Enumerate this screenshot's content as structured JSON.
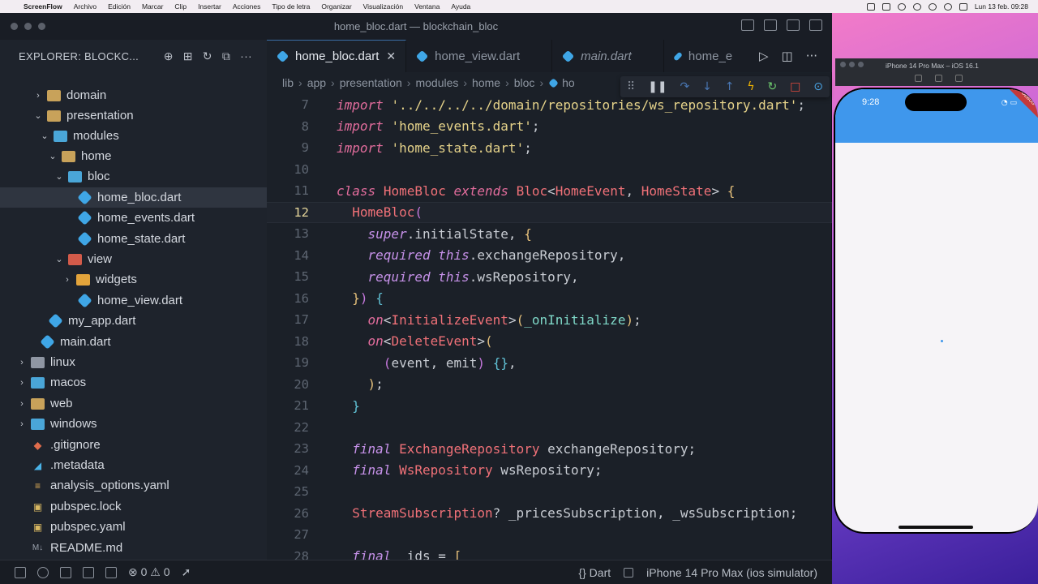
{
  "menubar": {
    "app": "ScreenFlow",
    "items": [
      "Archivo",
      "Edición",
      "Marcar",
      "Clip",
      "Insertar",
      "Acciones",
      "Tipo de letra",
      "Organizar",
      "Visualización",
      "Ventana",
      "Ayuda"
    ],
    "clock": "Lun 13 feb.  09:28"
  },
  "window": {
    "title": "home_bloc.dart — blockchain_bloc"
  },
  "explorer": {
    "header": "EXPLORER: BLOCKC...",
    "items": [
      {
        "label": "domain",
        "icon": "folder-icon"
      },
      {
        "label": "presentation",
        "icon": "folder-icon"
      },
      {
        "label": "modules",
        "icon": "modules-folder-icon"
      },
      {
        "label": "home",
        "icon": "folder-icon"
      },
      {
        "label": "bloc",
        "icon": "bloc-folder-icon"
      },
      {
        "label": "home_bloc.dart",
        "icon": "dart-icon"
      },
      {
        "label": "home_events.dart",
        "icon": "dart-icon"
      },
      {
        "label": "home_state.dart",
        "icon": "dart-icon"
      },
      {
        "label": "view",
        "icon": "view-folder-icon"
      },
      {
        "label": "widgets",
        "icon": "widgets-folder-icon"
      },
      {
        "label": "home_view.dart",
        "icon": "dart-icon"
      },
      {
        "label": "my_app.dart",
        "icon": "dart-icon"
      },
      {
        "label": "main.dart",
        "icon": "dart-icon"
      },
      {
        "label": "linux",
        "icon": "folder-icon"
      },
      {
        "label": "macos",
        "icon": "folder-icon"
      },
      {
        "label": "web",
        "icon": "folder-icon"
      },
      {
        "label": "windows",
        "icon": "folder-icon"
      },
      {
        "label": ".gitignore",
        "icon": "git-icon"
      },
      {
        "label": ".metadata",
        "icon": "metadata-icon"
      },
      {
        "label": "analysis_options.yaml",
        "icon": "yaml-icon"
      },
      {
        "label": "pubspec.lock",
        "icon": "lock-icon"
      },
      {
        "label": "pubspec.yaml",
        "icon": "yaml-icon"
      },
      {
        "label": "README.md",
        "icon": "markdown-icon"
      }
    ]
  },
  "tabs": [
    {
      "label": "home_bloc.dart",
      "active": true
    },
    {
      "label": "home_view.dart"
    },
    {
      "label": "main.dart"
    },
    {
      "label": "home_e"
    }
  ],
  "breadcrumb": [
    "lib",
    "app",
    "presentation",
    "modules",
    "home",
    "bloc",
    "ho"
  ],
  "code": {
    "lines": [
      {
        "n": "7",
        "text": "import '../../../../domain/repositories/ws_repository.dart';"
      },
      {
        "n": "8",
        "text": "import 'home_events.dart';"
      },
      {
        "n": "9",
        "text": "import 'home_state.dart';"
      },
      {
        "n": "10",
        "text": ""
      },
      {
        "n": "11",
        "text": "class HomeBloc extends Bloc<HomeEvent, HomeState> {"
      },
      {
        "n": "12",
        "text": "  HomeBloc("
      },
      {
        "n": "13",
        "text": "    super.initialState, {"
      },
      {
        "n": "14",
        "text": "    required this.exchangeRepository,"
      },
      {
        "n": "15",
        "text": "    required this.wsRepository,"
      },
      {
        "n": "16",
        "text": "  }) {"
      },
      {
        "n": "17",
        "text": "    on<InitializeEvent>(_onInitialize);"
      },
      {
        "n": "18",
        "text": "    on<DeleteEvent>("
      },
      {
        "n": "19",
        "text": "      (event, emit) {},"
      },
      {
        "n": "20",
        "text": "    );"
      },
      {
        "n": "21",
        "text": "  }"
      },
      {
        "n": "22",
        "text": ""
      },
      {
        "n": "23",
        "text": "  final ExchangeRepository exchangeRepository;"
      },
      {
        "n": "24",
        "text": "  final WsRepository wsRepository;"
      },
      {
        "n": "25",
        "text": ""
      },
      {
        "n": "26",
        "text": "  StreamSubscription? _pricesSubscription, _wsSubscription;"
      },
      {
        "n": "27",
        "text": ""
      },
      {
        "n": "28",
        "text": "  final _ids = ["
      }
    ]
  },
  "statusbar": {
    "errors": "0",
    "warnings": "0",
    "language": "Dart",
    "device": "iPhone 14 Pro Max (ios simulator)"
  },
  "simulator": {
    "title": "iPhone 14 Pro Max – iOS 16.1",
    "time": "9:28",
    "ribbon": "DEBUG"
  },
  "colors": {
    "accent": "#3f97ec",
    "keyword": "#e36d9d",
    "string": "#e6d38a",
    "class": "#f07178"
  }
}
